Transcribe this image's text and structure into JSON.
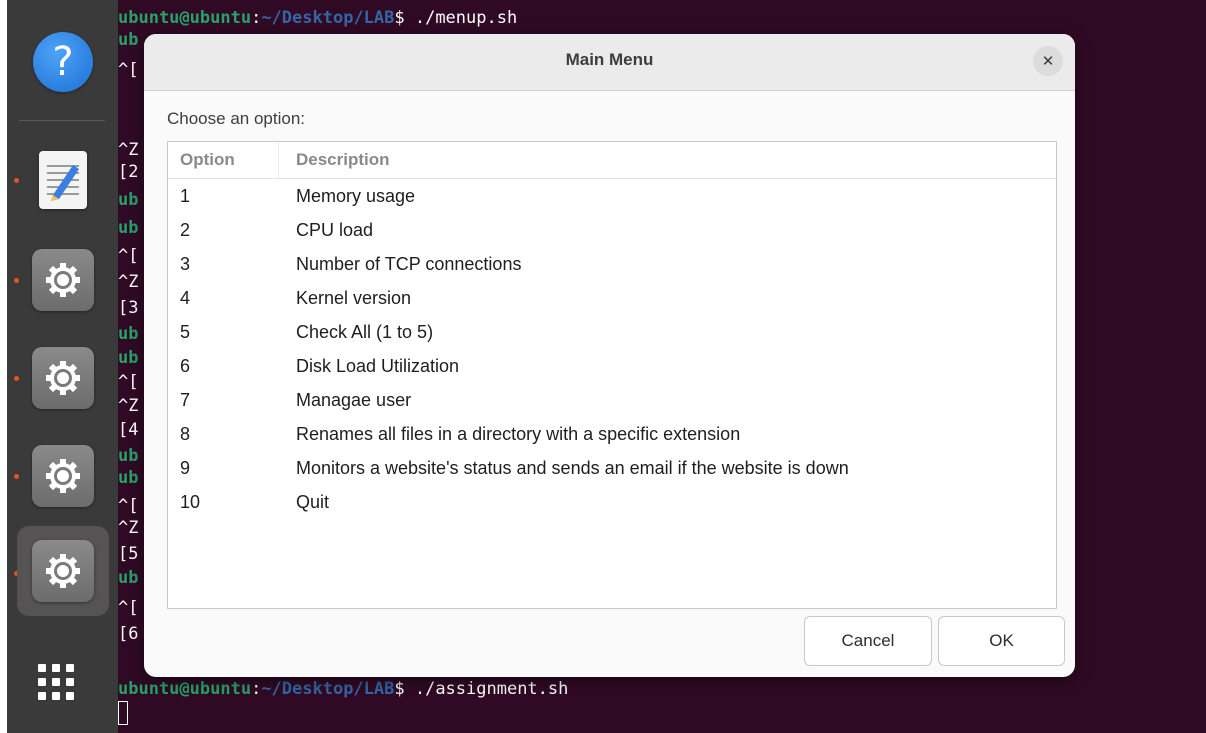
{
  "terminal": {
    "top_prompt": {
      "user": "ubuntu@ubuntu",
      "path": "~/Desktop/LAB",
      "command": "$ ./menup.sh"
    },
    "fragments": [
      "ub",
      "^[",
      "^Z",
      "[2",
      "ub",
      "ub",
      "^[",
      "^Z",
      "[3",
      "ub",
      "ub",
      "^[",
      "^Z",
      "[4",
      "ub",
      "ub",
      "^[",
      "^Z",
      "[5",
      "ub",
      "^[",
      "[6"
    ],
    "bottom_prompt": {
      "user": "ubuntu@ubuntu",
      "path": "~/Desktop/LAB",
      "command": "$ ./assignment.sh"
    }
  },
  "dock": {
    "items": [
      "help-icon",
      "text-editor-icon",
      "settings-icon",
      "settings-icon",
      "settings-icon",
      "settings-icon"
    ],
    "show_apps": "show-apps-icon"
  },
  "dialog": {
    "title": "Main Menu",
    "close_label": "✕",
    "prompt": "Choose an option:",
    "columns": [
      "Option",
      "Description"
    ],
    "rows": [
      {
        "option": "1",
        "description": "Memory usage"
      },
      {
        "option": "2",
        "description": "CPU load"
      },
      {
        "option": "3",
        "description": "Number of TCP connections"
      },
      {
        "option": "4",
        "description": "Kernel version"
      },
      {
        "option": "5",
        "description": "Check All (1 to  5)"
      },
      {
        "option": "6",
        "description": "Disk Load Utilization"
      },
      {
        "option": "7",
        "description": "Managae user"
      },
      {
        "option": "8",
        "description": "Renames all files in a directory with a specific extension"
      },
      {
        "option": "9",
        "description": "Monitors a website's status and sends an email if the website is down"
      },
      {
        "option": "10",
        "description": "Quit"
      }
    ],
    "cancel_label": "Cancel",
    "ok_label": "OK"
  },
  "colors": {
    "terminal_bg": "#300a24",
    "prompt_user": "#26a269",
    "prompt_path": "#3465a4",
    "running_indicator": "#e95420"
  }
}
